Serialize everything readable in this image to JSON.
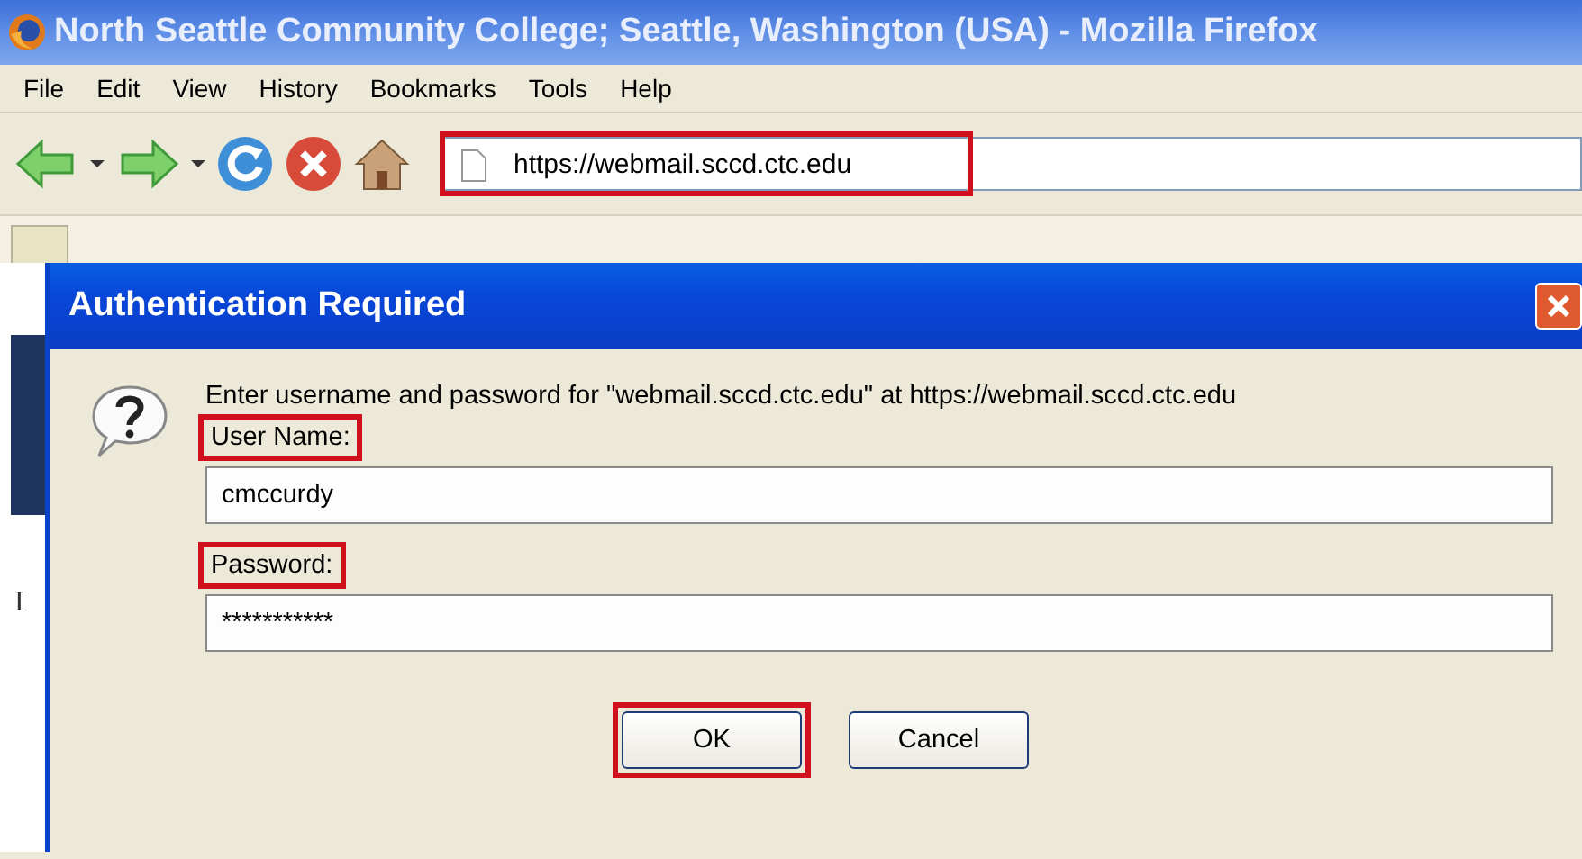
{
  "window": {
    "title": "North Seattle Community College; Seattle, Washington (USA) - Mozilla Firefox"
  },
  "menu": [
    {
      "label": "File"
    },
    {
      "label": "Edit"
    },
    {
      "label": "View"
    },
    {
      "label": "History"
    },
    {
      "label": "Bookmarks"
    },
    {
      "label": "Tools"
    },
    {
      "label": "Help"
    }
  ],
  "address_bar": {
    "value": "https://webmail.sccd.ctc.edu",
    "highlighted": true
  },
  "page": {
    "fragment": "I"
  },
  "dialog": {
    "title": "Authentication Required",
    "message": "Enter username and password for \"webmail.sccd.ctc.edu\" at https://webmail.sccd.ctc.edu",
    "fields": [
      {
        "label": "User Name:",
        "value": "cmccurdy",
        "highlighted": true
      },
      {
        "label": "Password:",
        "value": "***********",
        "highlighted": true
      }
    ],
    "buttons": [
      {
        "label": "OK",
        "highlighted": true
      },
      {
        "label": "Cancel",
        "highlighted": false
      }
    ]
  }
}
